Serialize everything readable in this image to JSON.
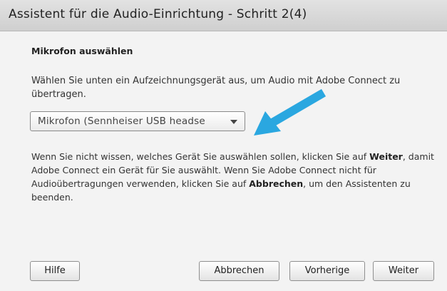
{
  "window": {
    "title": "Assistent für die Audio-Einrichtung - Schritt 2(4)"
  },
  "content": {
    "heading": "Mikrofon auswählen",
    "intro": "Wählen Sie unten ein Aufzeichnungsgerät aus, um Audio mit Adobe Connect zu übertragen.",
    "microphone_select": {
      "selected": "Mikrofon (Sennheiser USB headse"
    },
    "help_text": {
      "part1": "Wenn Sie nicht wissen, welches Gerät Sie auswählen sollen, klicken Sie auf ",
      "weiter": "Weiter",
      "part2": ", damit Adobe Connect ein Gerät für Sie auswählt. Wenn Sie Adobe Connect nicht für Audioübertragungen verwenden, klicken Sie auf ",
      "abbrechen": "Abbrechen",
      "part3": ", um den Assistenten zu beenden."
    }
  },
  "annotation": {
    "arrow_color": "#2aa7e0"
  },
  "buttons": {
    "help": "Hilfe",
    "cancel": "Abbrechen",
    "previous": "Vorherige",
    "next": "Weiter"
  }
}
